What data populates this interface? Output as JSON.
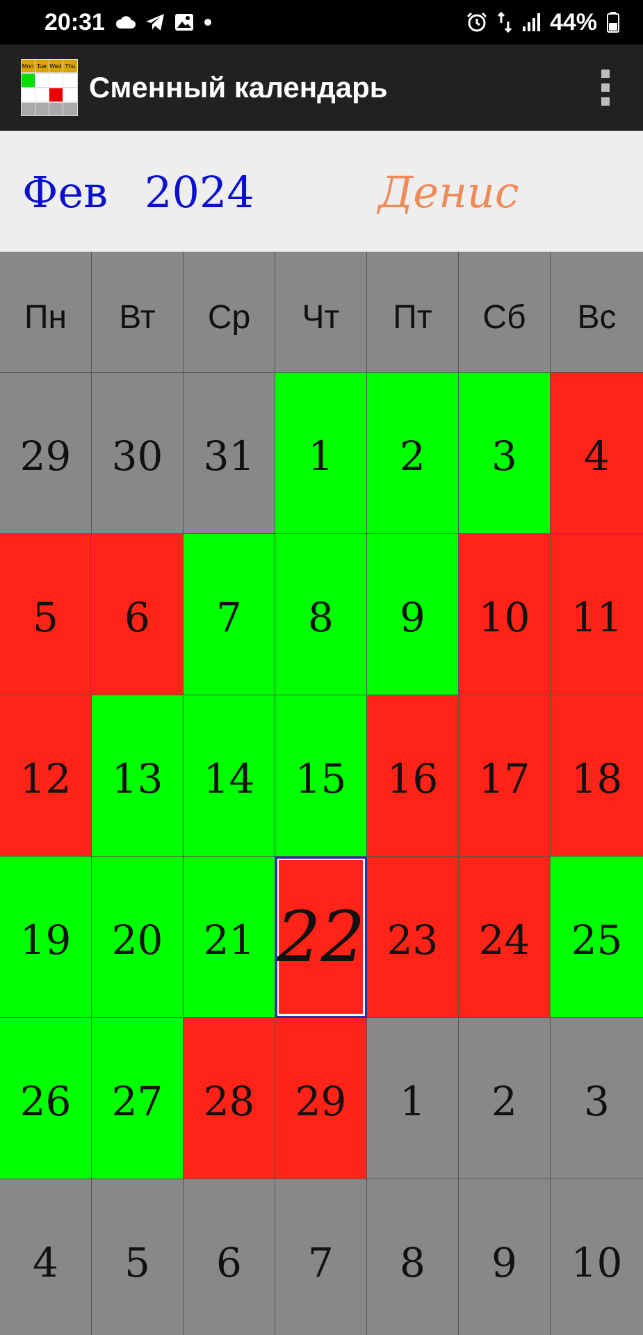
{
  "status_bar": {
    "time": "20:31",
    "battery": "44%",
    "left_icons": [
      "cloud-icon",
      "telegram-icon",
      "gallery-icon",
      "dot-icon"
    ],
    "right_icons": [
      "alarm-icon",
      "data-arrows-icon",
      "signal-icon",
      "battery-icon"
    ]
  },
  "app_bar": {
    "title": "Сменный календарь",
    "logo_labels": [
      "Mon",
      "Tue",
      "Wed",
      "Thu"
    ],
    "menu_icon": "more-vert-icon"
  },
  "header": {
    "month": "Фев",
    "year": "2024",
    "name": "Денис"
  },
  "weekdays": [
    "Пн",
    "Вт",
    "Ср",
    "Чт",
    "Пт",
    "Сб",
    "Вс"
  ],
  "colors": {
    "work": "#00ff00",
    "off": "#ff2318",
    "other_month": "#888888",
    "month_text": "#0a10cc",
    "name_text": "#ef8a5a"
  },
  "weeks": [
    [
      {
        "d": "29",
        "s": "other_month"
      },
      {
        "d": "30",
        "s": "other_month"
      },
      {
        "d": "31",
        "s": "other_month"
      },
      {
        "d": "1",
        "s": "work"
      },
      {
        "d": "2",
        "s": "work"
      },
      {
        "d": "3",
        "s": "work"
      },
      {
        "d": "4",
        "s": "off"
      }
    ],
    [
      {
        "d": "5",
        "s": "off"
      },
      {
        "d": "6",
        "s": "off"
      },
      {
        "d": "7",
        "s": "work"
      },
      {
        "d": "8",
        "s": "work"
      },
      {
        "d": "9",
        "s": "work"
      },
      {
        "d": "10",
        "s": "off"
      },
      {
        "d": "11",
        "s": "off"
      }
    ],
    [
      {
        "d": "12",
        "s": "off"
      },
      {
        "d": "13",
        "s": "work"
      },
      {
        "d": "14",
        "s": "work"
      },
      {
        "d": "15",
        "s": "work"
      },
      {
        "d": "16",
        "s": "off"
      },
      {
        "d": "17",
        "s": "off"
      },
      {
        "d": "18",
        "s": "off"
      }
    ],
    [
      {
        "d": "19",
        "s": "work"
      },
      {
        "d": "20",
        "s": "work"
      },
      {
        "d": "21",
        "s": "work"
      },
      {
        "d": "22",
        "s": "off",
        "today": true
      },
      {
        "d": "23",
        "s": "off"
      },
      {
        "d": "24",
        "s": "off"
      },
      {
        "d": "25",
        "s": "work"
      }
    ],
    [
      {
        "d": "26",
        "s": "work"
      },
      {
        "d": "27",
        "s": "work"
      },
      {
        "d": "28",
        "s": "off"
      },
      {
        "d": "29",
        "s": "off"
      },
      {
        "d": "1",
        "s": "other_month"
      },
      {
        "d": "2",
        "s": "other_month"
      },
      {
        "d": "3",
        "s": "other_month"
      }
    ],
    [
      {
        "d": "4",
        "s": "other_month"
      },
      {
        "d": "5",
        "s": "other_month"
      },
      {
        "d": "6",
        "s": "other_month"
      },
      {
        "d": "7",
        "s": "other_month"
      },
      {
        "d": "8",
        "s": "other_month"
      },
      {
        "d": "9",
        "s": "other_month"
      },
      {
        "d": "10",
        "s": "other_month"
      }
    ]
  ]
}
